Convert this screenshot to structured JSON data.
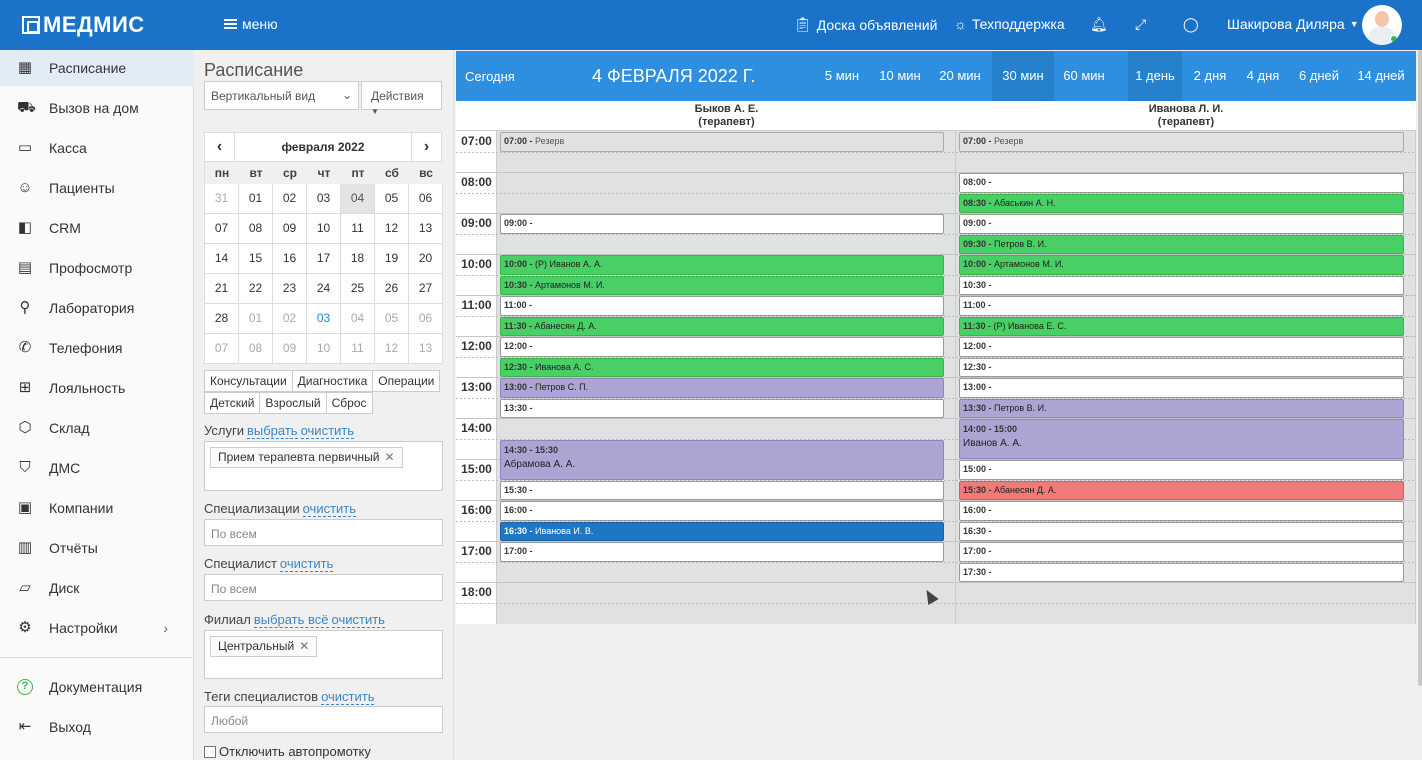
{
  "app": {
    "logo": "МЕДМИС",
    "menu_label": "меню",
    "board_label": "Доска объявлений",
    "support_label": "Техподдержка",
    "user_name": "Шакирова Диляра"
  },
  "sidebar": {
    "items": [
      {
        "label": "Расписание",
        "icon": "calendar-icon"
      },
      {
        "label": "Вызов на дом",
        "icon": "car-icon"
      },
      {
        "label": "Касса",
        "icon": "cash-icon"
      },
      {
        "label": "Пациенты",
        "icon": "user-icon"
      },
      {
        "label": "CRM",
        "icon": "crm-icon"
      },
      {
        "label": "Профосмотр",
        "icon": "book-icon"
      },
      {
        "label": "Лаборатория",
        "icon": "microscope-icon"
      },
      {
        "label": "Телефония",
        "icon": "phone-icon"
      },
      {
        "label": "Лояльность",
        "icon": "gift-icon"
      },
      {
        "label": "Склад",
        "icon": "box-icon"
      },
      {
        "label": "ДМС",
        "icon": "shield-icon"
      },
      {
        "label": "Компании",
        "icon": "briefcase-icon"
      },
      {
        "label": "Отчёты",
        "icon": "chart-icon"
      },
      {
        "label": "Диск",
        "icon": "folder-icon"
      },
      {
        "label": "Настройки",
        "icon": "gear-icon"
      }
    ],
    "bottom": [
      {
        "label": "Документация",
        "icon": "help-icon"
      },
      {
        "label": "Выход",
        "icon": "logout-icon"
      }
    ]
  },
  "filters": {
    "title": "Расписание",
    "view_select": "Вертикальный вид",
    "actions_label": "Действия",
    "calendar": {
      "month_label": "февраля 2022",
      "weekdays": [
        "пн",
        "вт",
        "ср",
        "чт",
        "пт",
        "сб",
        "вс"
      ],
      "weeks": [
        [
          "31",
          "01",
          "02",
          "03",
          "04",
          "05",
          "06"
        ],
        [
          "07",
          "08",
          "09",
          "10",
          "11",
          "12",
          "13"
        ],
        [
          "14",
          "15",
          "16",
          "17",
          "18",
          "19",
          "20"
        ],
        [
          "21",
          "22",
          "23",
          "24",
          "25",
          "26",
          "27"
        ],
        [
          "28",
          "01",
          "02",
          "03",
          "04",
          "05",
          "06"
        ],
        [
          "07",
          "08",
          "09",
          "10",
          "11",
          "12",
          "13"
        ]
      ]
    },
    "categories_row1": [
      "Консультации",
      "Диагностика",
      "Операции"
    ],
    "categories_row2": [
      "Детский",
      "Взрослый",
      "Сброс"
    ],
    "services_label": "Услуги",
    "select_link": "выбрать",
    "clear_link": "очистить",
    "service_tag": "Прием терапевта первичный",
    "spec_label": "Специализации",
    "spec_placeholder": "По всем",
    "specialist_label": "Специалист",
    "specialist_placeholder": "По всем",
    "branch_label": "Филиал",
    "select_all_link": "выбрать всё",
    "branch_tag": "Центральный",
    "tags_label": "Теги специалистов",
    "tags_placeholder": "Любой",
    "autopromote_label": "Отключить автопромотку"
  },
  "schedule": {
    "today_btn": "Сегодня",
    "date_title": "4 ФЕВРАЛЯ 2022 Г.",
    "zoom": [
      "5 мин",
      "10 мин",
      "20 мин",
      "30 мин",
      "60 мин"
    ],
    "zoom_selected": "30 мин",
    "range": [
      "1 день",
      "2 дня",
      "4 дня",
      "6 дней",
      "14 дней"
    ],
    "range_selected": "1 день",
    "hours": [
      "07:00",
      "08:00",
      "09:00",
      "10:00",
      "11:00",
      "12:00",
      "13:00",
      "14:00",
      "15:00",
      "16:00",
      "17:00",
      "18:00"
    ],
    "doctors": [
      {
        "name": "Быков А. Е.",
        "role": "(терапевт)",
        "slots": [
          {
            "time": "07:00 -",
            "text": "Резерв",
            "type": "reserve",
            "row": 0,
            "span": 1
          },
          {
            "time": "09:00 -",
            "text": "",
            "type": "free",
            "row": 4,
            "span": 1
          },
          {
            "time": "10:00 -",
            "text": "(Р) Иванов А. А.",
            "type": "green",
            "row": 6,
            "span": 1
          },
          {
            "time": "10:30 -",
            "text": "Артамонов М. И.",
            "type": "green",
            "row": 7,
            "span": 1
          },
          {
            "time": "11:00 -",
            "text": "",
            "type": "free",
            "row": 8,
            "span": 1
          },
          {
            "time": "11:30 -",
            "text": "Абанесян Д. А.",
            "type": "green",
            "row": 9,
            "span": 1
          },
          {
            "time": "12:00 -",
            "text": "",
            "type": "free",
            "row": 10,
            "span": 1
          },
          {
            "time": "12:30 -",
            "text": "Иванова А. С.",
            "type": "green",
            "row": 11,
            "span": 1
          },
          {
            "time": "13:00 -",
            "text": "Петров С. П.",
            "type": "purple",
            "row": 12,
            "span": 1
          },
          {
            "time": "13:30 -",
            "text": "",
            "type": "free",
            "row": 13,
            "span": 1
          },
          {
            "time": "14:30 - 15:30",
            "text": "Абрамова А. А.",
            "type": "purple",
            "row": 15,
            "span": 2
          },
          {
            "time": "15:30 -",
            "text": "",
            "type": "free",
            "row": 17,
            "span": 1
          },
          {
            "time": "16:00 -",
            "text": "",
            "type": "free",
            "row": 18,
            "span": 1
          },
          {
            "time": "16:30 -",
            "text": "Иванова И. В.",
            "type": "blue",
            "row": 19,
            "span": 1
          },
          {
            "time": "17:00 -",
            "text": "",
            "type": "free",
            "row": 20,
            "span": 1
          }
        ]
      },
      {
        "name": "Иванова Л. И.",
        "role": "(терапевт)",
        "slots": [
          {
            "time": "07:00 -",
            "text": "Резерв",
            "type": "reserve",
            "row": 0,
            "span": 1
          },
          {
            "time": "08:00 -",
            "text": "",
            "type": "free",
            "row": 2,
            "span": 1
          },
          {
            "time": "08:30 -",
            "text": "Абаськин А. Н.",
            "type": "green",
            "row": 3,
            "span": 1
          },
          {
            "time": "09:00 -",
            "text": "",
            "type": "free",
            "row": 4,
            "span": 1
          },
          {
            "time": "09:30 -",
            "text": "Петров В. И.",
            "type": "green",
            "row": 5,
            "span": 1
          },
          {
            "time": "10:00 -",
            "text": "Артамонов М. И.",
            "type": "green",
            "row": 6,
            "span": 1
          },
          {
            "time": "10:30 -",
            "text": "",
            "type": "free",
            "row": 7,
            "span": 1
          },
          {
            "time": "11:00 -",
            "text": "",
            "type": "free",
            "row": 8,
            "span": 1
          },
          {
            "time": "11:30 -",
            "text": "(Р) Иванова Е. С.",
            "type": "green",
            "row": 9,
            "span": 1
          },
          {
            "time": "12:00 -",
            "text": "",
            "type": "free",
            "row": 10,
            "span": 1
          },
          {
            "time": "12:30 -",
            "text": "",
            "type": "free",
            "row": 11,
            "span": 1
          },
          {
            "time": "13:00 -",
            "text": "",
            "type": "free",
            "row": 12,
            "span": 1
          },
          {
            "time": "13:30 -",
            "text": "Петров В. И.",
            "type": "purple",
            "row": 13,
            "span": 1
          },
          {
            "time": "14:00 - 15:00",
            "text": "Иванов А. А.",
            "type": "purple",
            "row": 14,
            "span": 2
          },
          {
            "time": "15:00 -",
            "text": "",
            "type": "free",
            "row": 16,
            "span": 1
          },
          {
            "time": "15:30 -",
            "text": "Абанесян Д. А.",
            "type": "red",
            "row": 17,
            "span": 1
          },
          {
            "time": "16:00 -",
            "text": "",
            "type": "free",
            "row": 18,
            "span": 1
          },
          {
            "time": "16:30 -",
            "text": "",
            "type": "free",
            "row": 19,
            "span": 1
          },
          {
            "time": "17:00 -",
            "text": "",
            "type": "free",
            "row": 20,
            "span": 1
          },
          {
            "time": "17:30 -",
            "text": "",
            "type": "free",
            "row": 21,
            "span": 1
          }
        ]
      }
    ]
  },
  "colors": {
    "topbar": "#1a73c9",
    "schedule_header": "#2e8fe0",
    "booked_green": "#48d066",
    "booked_purple": "#aca5d4",
    "booked_blue": "#1f76c2",
    "booked_red": "#f07a7a"
  }
}
